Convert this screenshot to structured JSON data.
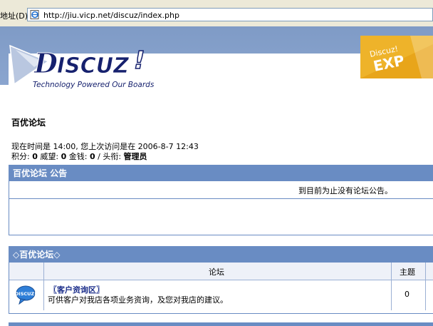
{
  "browser": {
    "address_label": "地址(D)",
    "url": "http://jiu.vicp.net/discuz/index.php"
  },
  "header": {
    "logo_text": "DISCUZ!",
    "logo_tagline": "Technology Powered Our Boards",
    "badge_text": "Discuz! EXP"
  },
  "forum": {
    "title": "百优论坛",
    "time_line": "现在时间是 14:00, 您上次访问是在  2006-8-7 12:43",
    "points_label": "积分:",
    "points": "0",
    "prestige_label": "威望:",
    "prestige": "0",
    "money_label": "金钱:",
    "money": "0",
    "rank_label": "/ 头衔:",
    "rank": "管理员"
  },
  "announcement": {
    "header": "百优论坛 公告",
    "text": "到目前为止没有论坛公告。"
  },
  "category": {
    "header": "◇百优论坛◇",
    "col_forum": "论坛",
    "col_topics": "主题",
    "rows": [
      {
        "icon": "discuz-bubble-icon",
        "name": "〖客户资询区〗",
        "description": "可供客户对我店各项业务资询，及您对我店的建议。",
        "topics": "0"
      }
    ]
  },
  "colors": {
    "header_bg": "#698cc3",
    "banner_bg": "#8aa5cf",
    "link": "#1a2d8a"
  }
}
